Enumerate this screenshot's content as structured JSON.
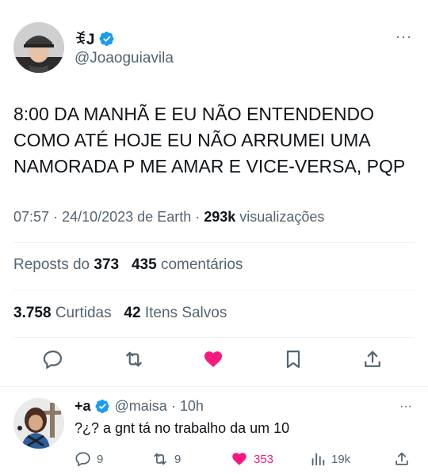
{
  "author": {
    "display_name": "ꉂJ",
    "handle": "@Joaoguiavila"
  },
  "tweet": {
    "text": "8:00 DA MANHÃ E EU NÃO ENTENDENDO COMO ATÉ HOJE EU NÃO ARRUMEI UMA NAMORADA P ME AMAR E VICE-VERSA, PQP",
    "time": "07:57",
    "date": "24/10/2023",
    "source": "de Earth",
    "views_count": "293k",
    "views_label": "visualizações",
    "more_icon": "···"
  },
  "stats": {
    "reposts_label": "Reposts do",
    "reposts_count": "373",
    "comments_count": "435",
    "comments_label": "comentários",
    "likes_count": "3.758",
    "likes_label": "Curtidas",
    "saves_count": "42",
    "saves_label": "Itens Salvos"
  },
  "actions": {
    "icons": [
      "reply-icon",
      "repost-icon",
      "like-icon",
      "bookmark-icon",
      "share-icon"
    ],
    "like_color": "#f91880"
  },
  "reply": {
    "display_name": "+a",
    "handle": "@maisa",
    "dot": "·",
    "time": "10h",
    "text": "?¿? a gnt tá no trabalho da um 10",
    "replies": "9",
    "reposts": "9",
    "likes": "353",
    "views": "19k",
    "more_icon": "···"
  },
  "colors": {
    "text": "#0f1419",
    "muted": "#536471",
    "verified": "#1d9bf0",
    "like": "#f91880",
    "divider": "#eff3f4"
  }
}
